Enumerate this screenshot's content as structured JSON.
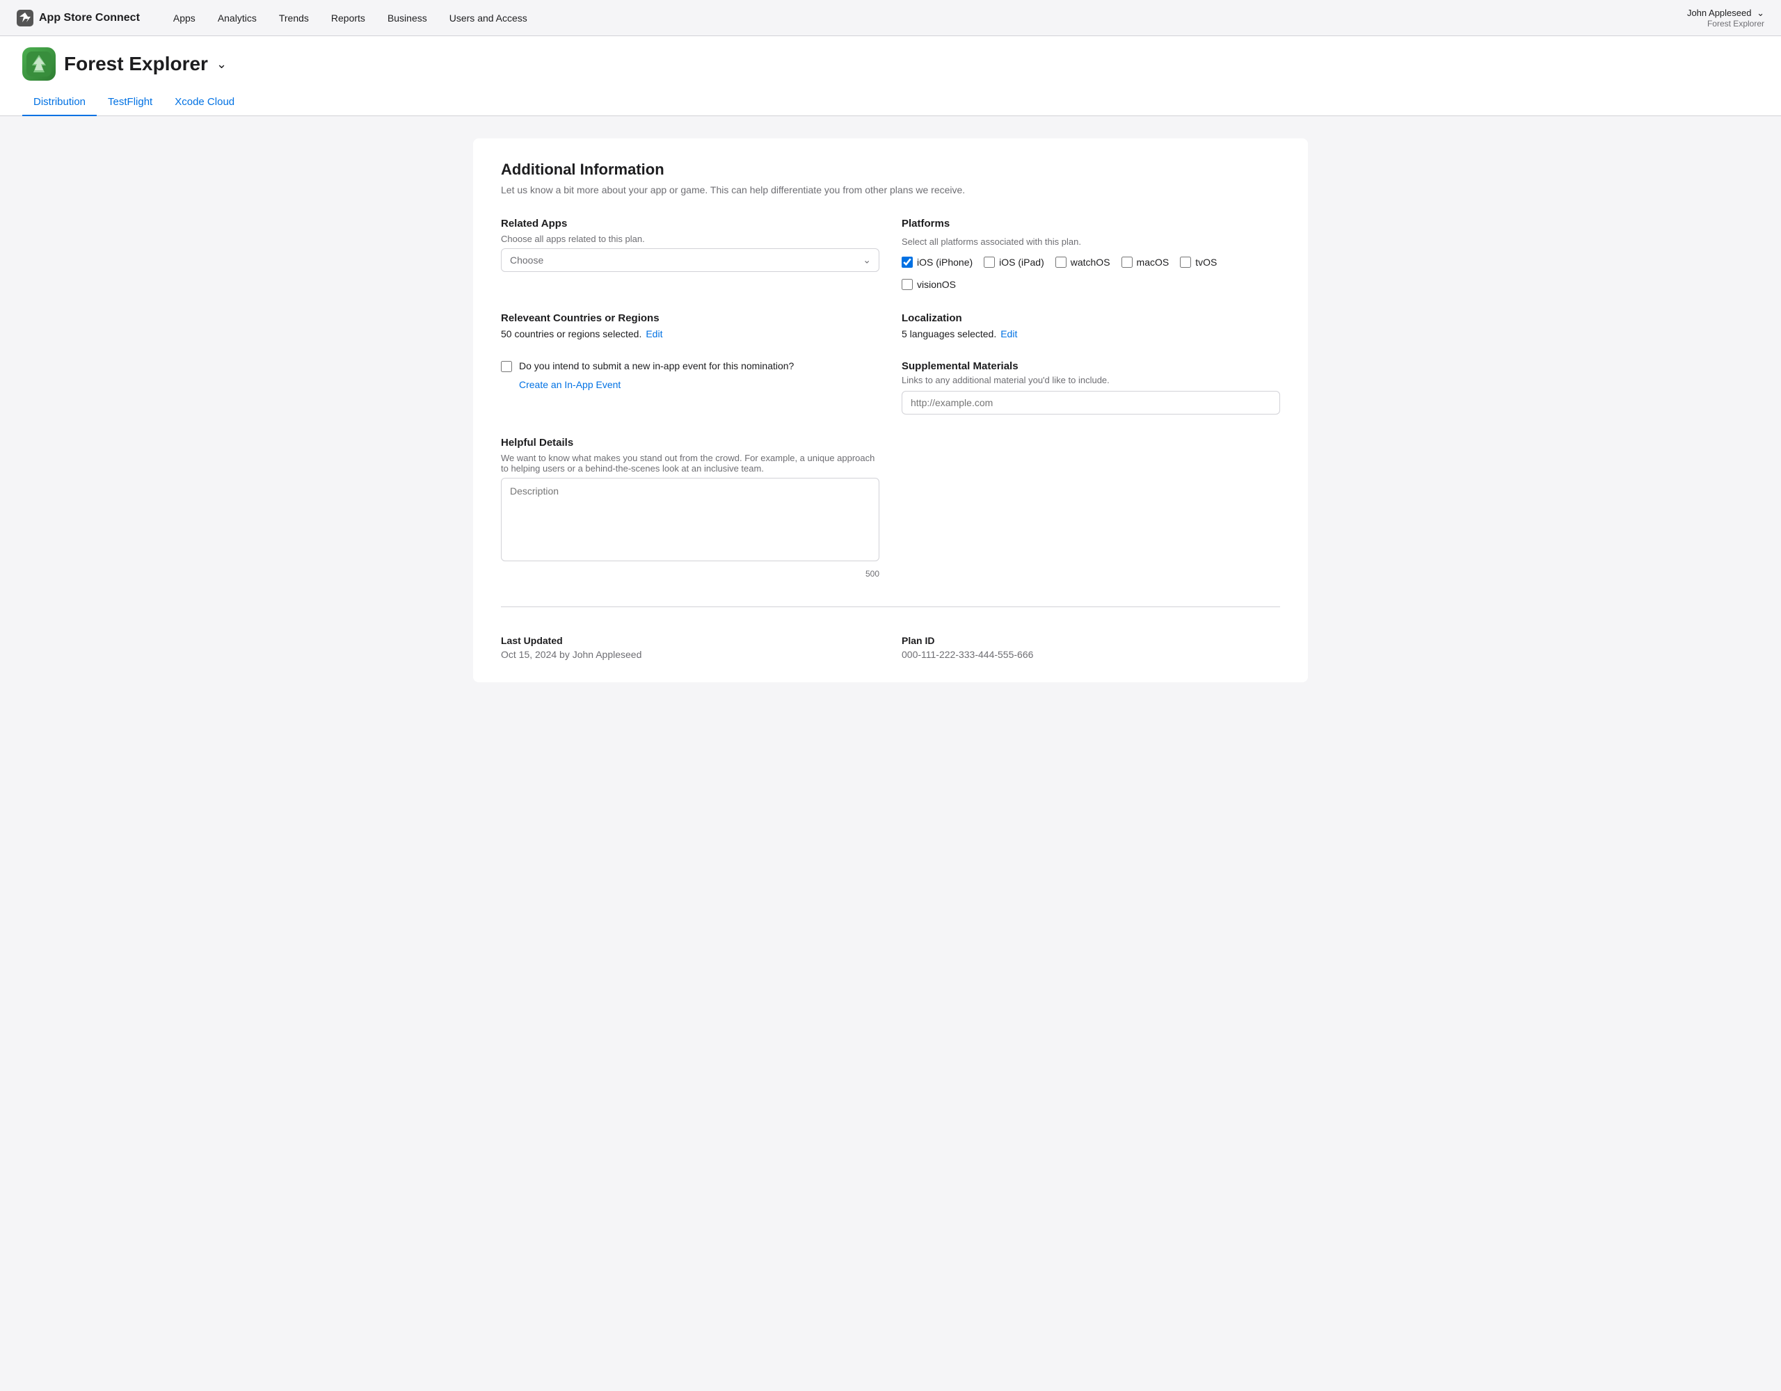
{
  "nav": {
    "logo_text": "App Store Connect",
    "links": [
      {
        "label": "Apps",
        "id": "apps"
      },
      {
        "label": "Analytics",
        "id": "analytics"
      },
      {
        "label": "Trends",
        "id": "trends"
      },
      {
        "label": "Reports",
        "id": "reports"
      },
      {
        "label": "Business",
        "id": "business"
      },
      {
        "label": "Users and Access",
        "id": "users"
      }
    ],
    "user_name": "John Appleseed",
    "user_chevron": "⌄",
    "user_app": "Forest Explorer"
  },
  "app_header": {
    "app_name": "Forest Explorer",
    "chevron": "⌄",
    "tabs": [
      {
        "label": "Distribution",
        "id": "distribution",
        "active": true
      },
      {
        "label": "TestFlight",
        "id": "testflight",
        "active": false
      },
      {
        "label": "Xcode Cloud",
        "id": "xcode-cloud",
        "active": false
      }
    ]
  },
  "page": {
    "title": "Additional Information",
    "description": "Let us know a bit more about your app or game. This can help differentiate you from other plans we receive.",
    "related_apps": {
      "label": "Related Apps",
      "sublabel": "Choose all apps related to this plan.",
      "select_placeholder": "Choose"
    },
    "platforms": {
      "label": "Platforms",
      "sublabel": "Select all platforms associated with this plan.",
      "items": [
        {
          "label": "iOS (iPhone)",
          "id": "iphone",
          "checked": true
        },
        {
          "label": "iOS (iPad)",
          "id": "ipad",
          "checked": false
        },
        {
          "label": "watchOS",
          "id": "watchos",
          "checked": false
        },
        {
          "label": "macOS",
          "id": "macos",
          "checked": false
        },
        {
          "label": "tvOS",
          "id": "tvos",
          "checked": false
        },
        {
          "label": "visionOS",
          "id": "visionos",
          "checked": false
        }
      ]
    },
    "countries": {
      "label": "Releveant Countries or Regions",
      "value": "50 countries or regions selected.",
      "edit_label": "Edit"
    },
    "localization": {
      "label": "Localization",
      "value": "5 languages selected.",
      "edit_label": "Edit"
    },
    "in_app_event": {
      "label": "Do you intend to submit a new in-app event for this nomination?",
      "checked": false,
      "create_label": "Create an In-App Event"
    },
    "supplemental": {
      "label": "Supplemental Materials",
      "sublabel": "Links to any additional material you'd like to include.",
      "placeholder": "http://example.com"
    },
    "helpful_details": {
      "label": "Helpful Details",
      "sublabel": "We want to know what makes you stand out from the crowd. For example, a unique approach to helping users or a behind-the-scenes look at an inclusive team.",
      "textarea_placeholder": "Description",
      "char_count": "500"
    },
    "footer": {
      "last_updated_label": "Last Updated",
      "last_updated_value": "Oct 15, 2024 by John Appleseed",
      "plan_id_label": "Plan ID",
      "plan_id_value": "000-111-222-333-444-555-666"
    }
  },
  "colors": {
    "accent": "#0071e3",
    "text_secondary": "#6e6e73",
    "border": "#d2d2d7"
  }
}
